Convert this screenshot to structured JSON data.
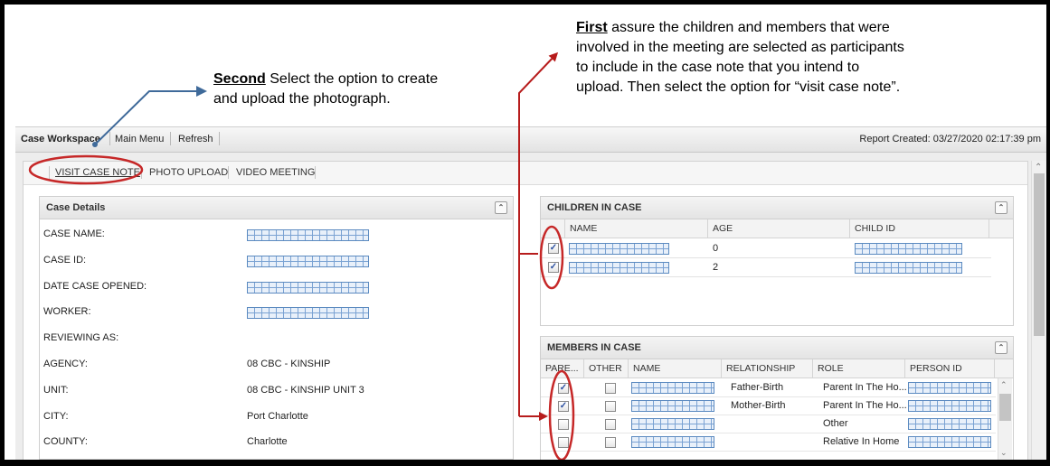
{
  "annotations": {
    "first": {
      "lead": "First",
      "lines": [
        " assure the children and members that were",
        "involved in the meeting are selected as participants",
        "to include in the case note that you intend to",
        "upload. Then select the option for “visit case note”."
      ]
    },
    "second": {
      "lead": "Second",
      "lines": [
        " Select the option to create",
        "and upload the photograph."
      ]
    },
    "colors": {
      "first_arrow": "#b71c1c",
      "second_arrow": "#3f6a9a",
      "highlight_ring": "#c62828"
    }
  },
  "topbar": {
    "items": [
      "Case Workspace",
      "Main Menu",
      "Refresh"
    ],
    "report_created": "Report Created: 03/27/2020 02:17:39 pm"
  },
  "tabs": [
    "VISIT CASE NOTE",
    "PHOTO UPLOAD",
    "VIDEO MEETING"
  ],
  "case_details": {
    "title": "Case Details",
    "rows": [
      {
        "label": "CASE NAME:",
        "value": "",
        "redacted": true
      },
      {
        "label": "CASE ID:",
        "value": "",
        "redacted": true
      },
      {
        "label": "DATE CASE OPENED:",
        "value": "",
        "redacted": true
      },
      {
        "label": "WORKER:",
        "value": "",
        "redacted": true
      },
      {
        "label": "REVIEWING AS:",
        "value": "",
        "redacted": false
      },
      {
        "label": "AGENCY:",
        "value": "08 CBC - KINSHIP",
        "redacted": false
      },
      {
        "label": "UNIT:",
        "value": "08 CBC - KINSHIP UNIT 3",
        "redacted": false
      },
      {
        "label": "CITY:",
        "value": "Port Charlotte",
        "redacted": false
      },
      {
        "label": "COUNTY:",
        "value": "Charlotte",
        "redacted": false
      }
    ]
  },
  "children": {
    "title": "CHILDREN IN CASE",
    "columns": [
      "NAME",
      "AGE",
      "CHILD ID"
    ],
    "rows": [
      {
        "checked": true,
        "age": "0"
      },
      {
        "checked": true,
        "age": "2"
      }
    ]
  },
  "members": {
    "title": "MEMBERS IN CASE",
    "columns": [
      "PARE...",
      "OTHER",
      "NAME",
      "RELATIONSHIP",
      "ROLE",
      "PERSON ID"
    ],
    "rows": [
      {
        "parent": true,
        "other": false,
        "relationship": "Father-Birth",
        "role": "Parent In The Ho..."
      },
      {
        "parent": true,
        "other": false,
        "relationship": "Mother-Birth",
        "role": "Parent In The Ho..."
      },
      {
        "parent": false,
        "other": false,
        "relationship": "",
        "role": "Other"
      },
      {
        "parent": false,
        "other": false,
        "relationship": "",
        "role": "Relative In Home"
      }
    ]
  }
}
